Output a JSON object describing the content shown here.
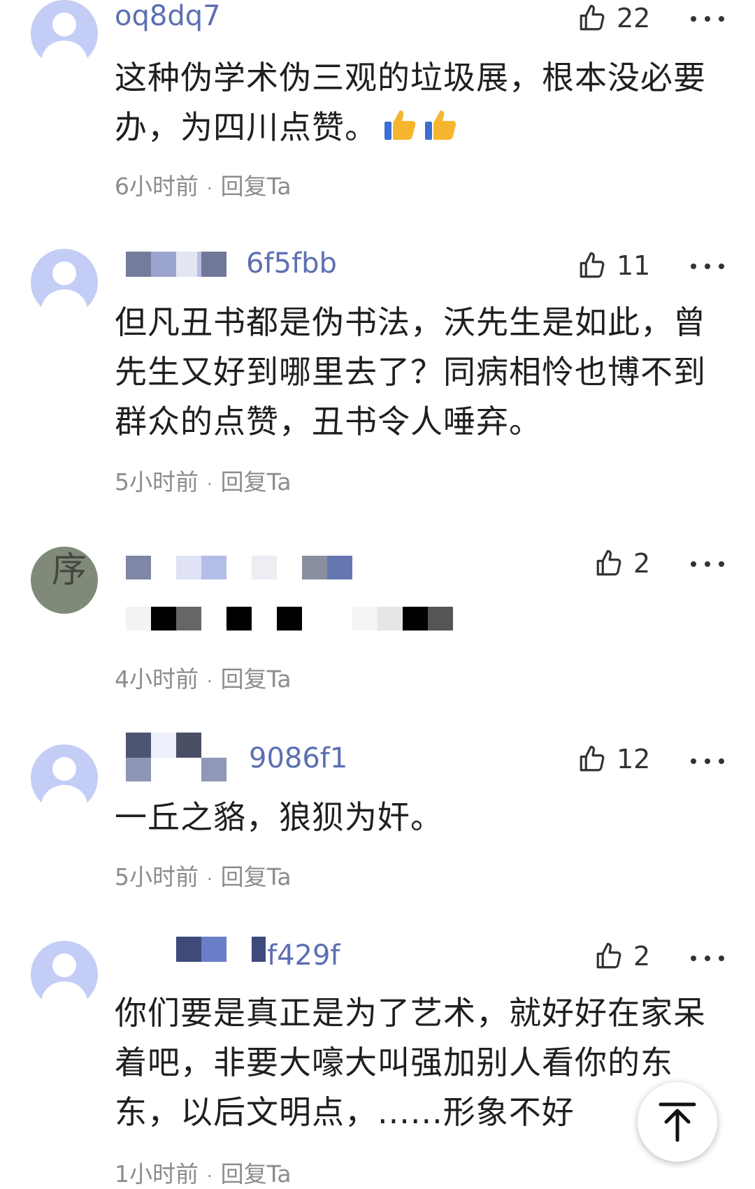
{
  "comments": [
    {
      "username": "oq8dq7",
      "likes": "22",
      "text": "这种伪学术伪三观的垃圾展，根本没必要办，为四川点赞。",
      "time": "6小时前",
      "reply": "回复Ta"
    },
    {
      "username": "6f5fbb",
      "likes": "11",
      "text": "但凡丑书都是伪书法，沃先生是如此，曾先生又好到哪里去了？同病相怜也博不到群众的点赞，丑书令人唾弃。",
      "time": "5小时前",
      "reply": "回复Ta"
    },
    {
      "username": "",
      "likes": "2",
      "text": "",
      "time": "4小时前",
      "reply": "回复Ta"
    },
    {
      "username": "9086f1",
      "likes": "12",
      "text": "一丘之貉，狼狈为奸。",
      "time": "5小时前",
      "reply": "回复Ta"
    },
    {
      "username": "f429f",
      "likes": "2",
      "text": "你们要是真正是为了艺术，就好好在家呆着吧，非要大嚎大叫强加别人看你的东东，以后文明点，......形象不好",
      "time": "1小时前",
      "reply": "回复Ta"
    }
  ],
  "icons": {
    "like": "thumbs-up-outline-icon",
    "more": "more-dots-icon",
    "scroll_top": "arrow-up-icon",
    "emoji": "thumbs-up-emoji-icon"
  },
  "colors": {
    "username": "#5c6fb2",
    "text": "#1f1f1f",
    "meta": "#8c8c8c",
    "avatar": "#c3cdf5"
  }
}
